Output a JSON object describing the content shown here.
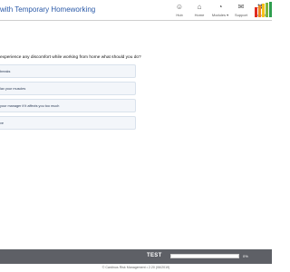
{
  "header": {
    "title": "with Temporary Homeworking",
    "nav": [
      {
        "label": "Hub",
        "icon": "person-icon",
        "glyph": "☺"
      },
      {
        "label": "Home",
        "icon": "home-icon",
        "glyph": "⌂"
      },
      {
        "label": "Modules ▾",
        "icon": "dashboard-icon",
        "glyph": "◔"
      },
      {
        "label": "Support",
        "icon": "chat-icon",
        "glyph": "✉"
      },
      {
        "label": "Logout",
        "icon": "close-icon",
        "glyph": "✖"
      }
    ],
    "brand_colors": [
      "#e02b20",
      "#f0861f",
      "#f6c21a",
      "#7fb33d",
      "#2e9e4f"
    ]
  },
  "question": {
    "text": "experience any discomfort while working from home what should you do?"
  },
  "options": [
    {
      "label": "breaks"
    },
    {
      "label": "lax your muscles"
    },
    {
      "label": "your manager if it affects you too much"
    },
    {
      "label": "ve"
    }
  ],
  "footer": {
    "test_label": "TEST",
    "progress_percent": 0,
    "progress_text": "0%",
    "copyright": "© Cardinus Risk Management • 2.20 (06/2019)"
  },
  "colors": {
    "accent": "#2b5aa8",
    "footer_bg": "#5e6066"
  }
}
